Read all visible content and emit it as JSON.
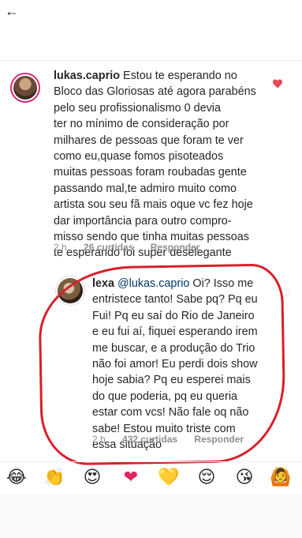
{
  "comment1": {
    "username": "lukas.caprio",
    "text": " Estou te esperando no\nBloco das Gloriosas até agora parabéns\npelo seu profissionalismo 0 devia\nter no mínimo de consideração por\nmilhares de pessoas que foram te ver\ncomo eu,quase fomos pisoteados\nmuitas pessoas foram roubadas gente\npassando mal,te admiro muito como\nartista sou seu fã mais oque vc fez hoje\ndar importância para outro compro-\nmisso sendo que tinha muitas pessoas\nte esperando foi super deselegante",
    "time": "2 h",
    "likes": "26 curtidas",
    "reply": "Responder",
    "liked": true
  },
  "comment2": {
    "username": "lexa",
    "mention": "@lukas.caprio",
    "text": " Oi? Isso me\nentristece tanto! Sabe pq? Pq eu\nFui! Pq eu saí do Rio de Janeiro\ne eu fui aí, fiquei esperando irem\nme buscar, e a produção do Trio\nnão foi amor! Eu perdi dois show\nhoje sabia? Pq eu esperei mais\ndo que poderia, pq eu queria\nestar com vcs! Não fale oq não\nsabe! Estou muito triste com\nessa situação",
    "time": "2 h",
    "likes": "432 curtidas",
    "reply": "Responder"
  },
  "reactions": [
    "😂",
    "👏",
    "😍",
    "❤",
    "💛",
    "😌",
    "😘",
    "🙆"
  ],
  "colors": {
    "like_heart": "#ed4956",
    "annotation_ring": "#d8202b",
    "meta_gray": "#8e8e8e"
  }
}
